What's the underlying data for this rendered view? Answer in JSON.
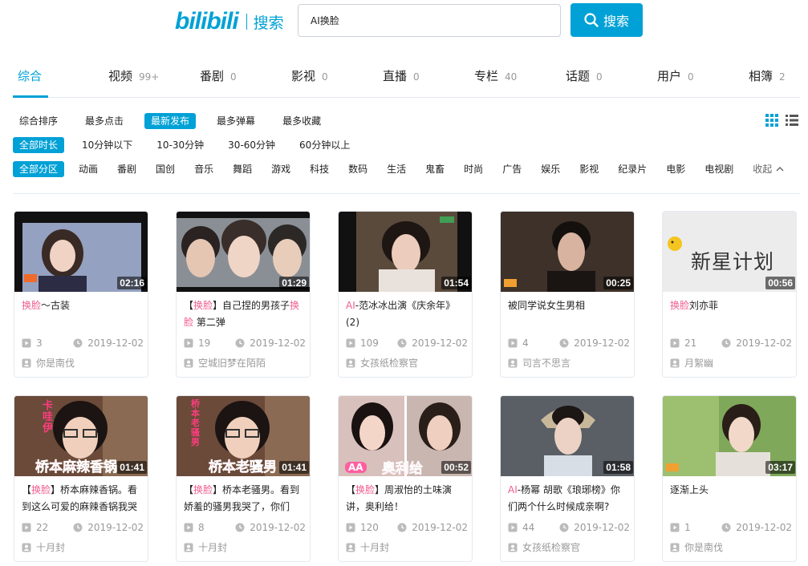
{
  "header": {
    "logo_text": "bilibili",
    "logo_suffix": "搜索",
    "search_value": "AI换脸",
    "search_button": "搜索"
  },
  "tabs": [
    {
      "label": "综合",
      "count": ""
    },
    {
      "label": "视频",
      "count": "99+"
    },
    {
      "label": "番剧",
      "count": "0"
    },
    {
      "label": "影视",
      "count": "0"
    },
    {
      "label": "直播",
      "count": "0"
    },
    {
      "label": "专栏",
      "count": "40"
    },
    {
      "label": "话题",
      "count": "0"
    },
    {
      "label": "用户",
      "count": "0"
    },
    {
      "label": "相簿",
      "count": "2"
    }
  ],
  "sort_options": [
    "综合排序",
    "最多点击",
    "最新发布",
    "最多弹幕",
    "最多收藏"
  ],
  "sort_active": "最新发布",
  "duration_options": [
    "全部时长",
    "10分钟以下",
    "10-30分钟",
    "30-60分钟",
    "60分钟以上"
  ],
  "category_options": [
    "全部分区",
    "动画",
    "番剧",
    "国创",
    "音乐",
    "舞蹈",
    "游戏",
    "科技",
    "数码",
    "生活",
    "鬼畜",
    "时尚",
    "广告",
    "娱乐",
    "影视",
    "纪录片",
    "电影",
    "电视剧"
  ],
  "collapse_label": "收起",
  "colors": {
    "accent": "#00a1d6",
    "highlight": "#f25d8e",
    "muted": "#999999"
  },
  "videos": [
    {
      "title_parts": [
        {
          "t": "换脸",
          "h": true
        },
        {
          "t": "～古装",
          "h": false
        }
      ],
      "duration": "02:16",
      "plays": "3",
      "date": "2019-12-02",
      "author": "你是南伐"
    },
    {
      "title_parts": [
        {
          "t": "【",
          "h": false
        },
        {
          "t": "换脸",
          "h": true
        },
        {
          "t": "】自己捏的男孩子",
          "h": false
        },
        {
          "t": "换脸",
          "h": true
        },
        {
          "t": " 第二弹",
          "h": false
        }
      ],
      "duration": "01:29",
      "plays": "19",
      "date": "2019-12-02",
      "author": "空城旧梦在陌陌"
    },
    {
      "title_parts": [
        {
          "t": "AI",
          "h": true
        },
        {
          "t": "-范冰冰出演《庆余年》(2)",
          "h": false
        }
      ],
      "duration": "01:54",
      "plays": "109",
      "date": "2019-12-02",
      "author": "女孩纸检察官"
    },
    {
      "title_parts": [
        {
          "t": "被同学说女生男相",
          "h": false
        }
      ],
      "duration": "00:25",
      "plays": "4",
      "date": "2019-12-02",
      "author": "司言不思言"
    },
    {
      "title_parts": [
        {
          "t": "换脸",
          "h": true
        },
        {
          "t": "刘亦菲",
          "h": false
        }
      ],
      "duration": "00:56",
      "plays": "21",
      "date": "2019-12-02",
      "author": "月絮幽"
    },
    {
      "title_parts": [
        {
          "t": "【",
          "h": false
        },
        {
          "t": "换脸",
          "h": true
        },
        {
          "t": "】桥本麻辣香锅。看到这么可爱的麻辣香锅我哭",
          "h": false
        }
      ],
      "duration": "01:41",
      "plays": "22",
      "date": "2019-12-02",
      "author": "十月封"
    },
    {
      "title_parts": [
        {
          "t": "【",
          "h": false
        },
        {
          "t": "换脸",
          "h": true
        },
        {
          "t": "】桥本老骚男。看到娇羞的骚男我哭了，你们",
          "h": false
        }
      ],
      "duration": "01:41",
      "plays": "8",
      "date": "2019-12-02",
      "author": "十月封"
    },
    {
      "title_parts": [
        {
          "t": "【",
          "h": false
        },
        {
          "t": "换脸",
          "h": true
        },
        {
          "t": "】周淑怡的土味演讲，奥利给！",
          "h": false
        }
      ],
      "duration": "00:52",
      "plays": "120",
      "date": "2019-12-02",
      "author": "十月封"
    },
    {
      "title_parts": [
        {
          "t": "AI",
          "h": true
        },
        {
          "t": "-杨幂 胡歌《琅琊榜》你们两个什么时候成亲啊?",
          "h": false
        }
      ],
      "duration": "01:58",
      "plays": "44",
      "date": "2019-12-02",
      "author": "女孩纸检察官"
    },
    {
      "title_parts": [
        {
          "t": "逐渐上头",
          "h": false
        }
      ],
      "duration": "03:17",
      "plays": "1",
      "date": "2019-12-02",
      "author": "你是南伐"
    }
  ],
  "thumb_overlays": {
    "v4": "新星计划",
    "v5": "桥本麻辣香锅",
    "v5_side": "卡哇伊",
    "v6": "桥本老骚男",
    "v6_side": "桥本老骚男",
    "v7": "奥利给",
    "v7_small": "AA"
  }
}
